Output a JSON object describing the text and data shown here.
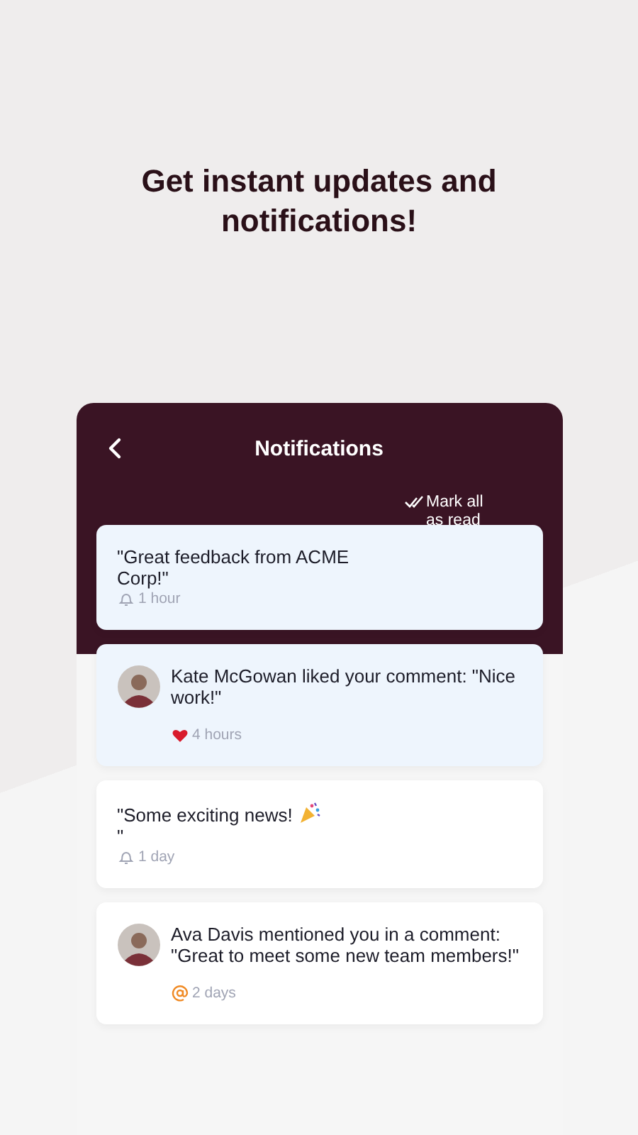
{
  "headline": "Get instant updates and notifications!",
  "screen": {
    "title": "Notifications",
    "mark_all": "Mark all as read"
  },
  "notifications": [
    {
      "kind": "bell",
      "avatar": false,
      "unread": true,
      "text": "\"Great feedback from ACME Corp!\"",
      "party": false,
      "time": "1 hour"
    },
    {
      "kind": "like",
      "avatar": true,
      "unread": true,
      "text": "Kate McGowan liked your comment: \"Nice work!\"",
      "party": false,
      "time": "4 hours"
    },
    {
      "kind": "bell",
      "avatar": false,
      "unread": false,
      "text": "\"Some exciting news!",
      "party": true,
      "trailing": "\"",
      "time": "1 day"
    },
    {
      "kind": "mention",
      "avatar": true,
      "unread": false,
      "text": "Ava Davis mentioned you in a comment: \"Great to meet some new team members!\"",
      "party": false,
      "time": "2 days"
    }
  ]
}
